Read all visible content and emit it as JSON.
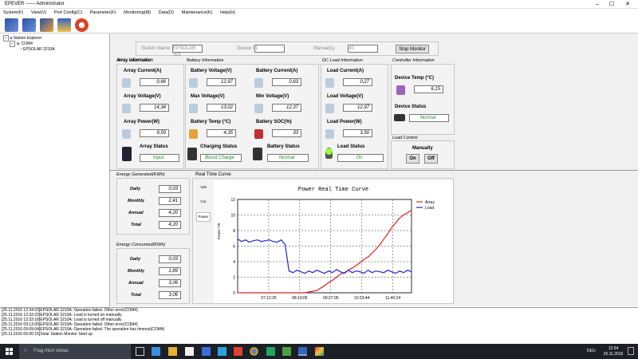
{
  "window": {
    "title": "EPEVER ------ Administrator",
    "min": "–",
    "max": "☐",
    "close": "✕"
  },
  "menu": [
    "System(F)",
    "View(V)",
    "Port Config(C)",
    "Parameter(F)",
    "Monitoring(M)",
    "Data(D)",
    "Maintenance(K)",
    "Help(H)"
  ],
  "toolbar": {
    "icons": [
      "solar-panel-icon",
      "solar-panel-icon",
      "solar-panel-settings-icon",
      "printer-icon",
      "power-icon"
    ]
  },
  "tree": {
    "root": "Station Explorer",
    "port": "COM4",
    "device": "EPSOLAR 3210A",
    "expand_minus": "−"
  },
  "device_bar": {
    "station_label": "Station Name",
    "station_value": "EPSOLAR 321",
    "device_id_label": "Device ID",
    "device_id_value": "1",
    "manual_label": "Manual(s)",
    "manual_value": "40",
    "stop_button": "Stop Monitor"
  },
  "array": {
    "title": "Array Information",
    "current_label": "Array Current(A)",
    "current": "0,66",
    "voltage_label": "Array Voltage(V)",
    "voltage": "14,34",
    "power_label": "Array Power(W)",
    "power": "9,59",
    "status_label": "Array Status",
    "status": "Input"
  },
  "battery": {
    "title": "Battery Information",
    "voltage_label": "Battery Voltage(V)",
    "voltage": "12,97",
    "max_label": "Max Voltage(V)",
    "max": "13,02",
    "temp_label": "Battery Temp (°C)",
    "temp": "4,35",
    "charging_label": "Charging Status",
    "charging": "Boost Charge",
    "current_label": "Battery Current(A)",
    "current": "0,63",
    "min_label": "Min Voltage(V)",
    "min": "12,37",
    "soc_label": "Battery SOC(%)",
    "soc": "33",
    "status_label": "Battery Status",
    "status": "Normal"
  },
  "load": {
    "title": "DC Load Information",
    "current_label": "Load Current(A)",
    "current": "0,27",
    "voltage_label": "Load Voltage(V)",
    "voltage": "12,97",
    "power_label": "Load Power(W)",
    "power": "3,50",
    "status_label": "Load Status",
    "status": "On"
  },
  "controller": {
    "title": "Controller Information",
    "temp_label": "Device Temp (°C)",
    "temp": "6,15",
    "status_label": "Device Status",
    "status": "Normal"
  },
  "load_control": {
    "title": "Load Control",
    "manually": "Manually",
    "on": "On",
    "off": "Off"
  },
  "energy_generated": {
    "title": "Energy Generated(KWh)",
    "rows": [
      {
        "label": "Daily",
        "value": "0,03"
      },
      {
        "label": "Monthly",
        "value": "2,41"
      },
      {
        "label": "Annual",
        "value": "4,20"
      },
      {
        "label": "Total",
        "value": "4,20"
      }
    ]
  },
  "energy_consumed": {
    "title": "Energy Consumed(KWh)",
    "rows": [
      {
        "label": "Daily",
        "value": "0,03"
      },
      {
        "label": "Monthly",
        "value": "1,89"
      },
      {
        "label": "Annual",
        "value": "3,06"
      },
      {
        "label": "Total",
        "value": "3,06"
      }
    ]
  },
  "realtime": {
    "title": "Real Time Curve",
    "tabs": [
      "Volt",
      "Cur",
      "Power"
    ],
    "active_tab": "Power"
  },
  "chart_data": {
    "type": "line",
    "title": "Power Real Time Curve",
    "ylabel": "Power / W",
    "xlabel": "",
    "ylim": [
      0,
      12
    ],
    "yticks": [
      0,
      2,
      4,
      6,
      8,
      10,
      12
    ],
    "xticks": [
      "07:12:25",
      "08:19:05",
      "09:27:05",
      "10:33:44",
      "11:40:24"
    ],
    "legend_position": "top-right",
    "grid": true,
    "series": [
      {
        "name": "Array",
        "color": "#e02020",
        "values": [
          0,
          0,
          0,
          0,
          0,
          0,
          0,
          0,
          0,
          0,
          0,
          0,
          0,
          0,
          0,
          0,
          0,
          0,
          0.1,
          0.2,
          0.3,
          0.6,
          0.9,
          1.3,
          1.6,
          2.0,
          2.4,
          2.6,
          2.9,
          3.2,
          3.5,
          3.9,
          4.3,
          4.6,
          5.1,
          5.6,
          6.2,
          6.9,
          7.6,
          8.4,
          9.0,
          9.6,
          10.0,
          10.3,
          10.6
        ]
      },
      {
        "name": "Load",
        "color": "#2020e0",
        "values": [
          6.9,
          6.6,
          6.8,
          6.5,
          6.7,
          6.8,
          6.6,
          6.7,
          6.8,
          6.6,
          6.5,
          6.8,
          6.2,
          2.8,
          2.6,
          2.9,
          2.7,
          2.5,
          2.8,
          2.6,
          2.9,
          2.7,
          2.5,
          2.8,
          2.6,
          3.0,
          2.7,
          2.5,
          2.9,
          2.6,
          2.8,
          2.7,
          2.5,
          2.9,
          2.6,
          2.8,
          2.7,
          2.6,
          2.9,
          2.7,
          2.5,
          2.8,
          2.6,
          2.9,
          2.7
        ]
      }
    ]
  },
  "log": [
    "[25.11.2016 12:34:03]EPSOLAR 3210A: Operation failed. Other error(COM4)",
    "[25.11.2016 12:33:22]EPSOLAR 3210A: Load is turned on manually",
    "[25.11.2016 12:33:18]EPSOLAR 3210A: Load is turned off manually",
    "[25.11.2016 09:13:05]EPSOLAR 3210A: Operation failed. Other error(COM4)",
    "[25.11.2016 09:09:04]EPSOLAR 3210A: Operation failed. The operation has timeout(COM4)",
    "[25.11.2016 06:06:15]Solar Station Monitor Start up"
  ],
  "taskbar": {
    "search_placeholder": "Frag mich etwas",
    "lang": "DEU",
    "time": "12:34",
    "date": "25.11.2016"
  },
  "colors": {
    "accent": "#1a8a2a",
    "array": "#e02020",
    "load": "#2020e0",
    "taskbar": "#1c1f26"
  }
}
